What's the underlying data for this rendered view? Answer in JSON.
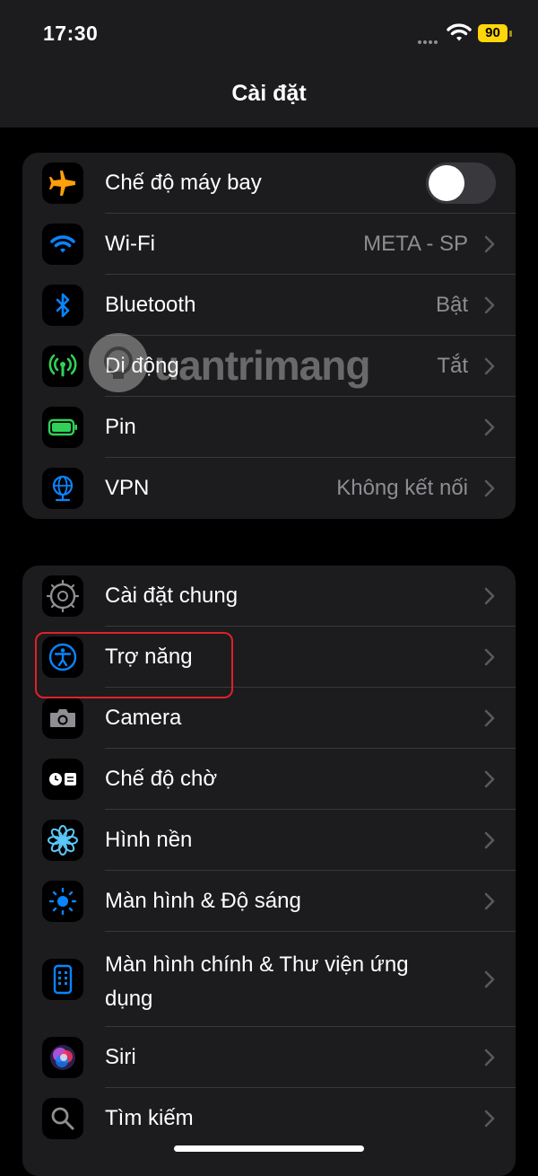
{
  "status_bar": {
    "time": "17:30",
    "battery_level": "90",
    "battery_color": "#ffd60a"
  },
  "navigation": {
    "title": "Cài đặt"
  },
  "group1": [
    {
      "label": "Chế độ máy bay",
      "value": "",
      "icon": "airplane-icon",
      "toggle": false,
      "icon_color": "#ff9f0a"
    },
    {
      "label": "Wi-Fi",
      "value": "META - SP",
      "icon": "wifi-icon",
      "icon_color": "#0a84ff"
    },
    {
      "label": "Bluetooth",
      "value": "Bật",
      "icon": "bluetooth-icon",
      "icon_color": "#0a84ff"
    },
    {
      "label": "Di động",
      "value": "Tắt",
      "icon": "cellular-icon",
      "icon_color": "#30d158"
    },
    {
      "label": "Pin",
      "value": "",
      "icon": "battery-icon",
      "icon_color": "#30d158"
    },
    {
      "label": "VPN",
      "value": "Không kết nối",
      "icon": "globe-icon",
      "icon_color": "#0a84ff"
    }
  ],
  "group2": [
    {
      "label": "Cài đặt chung",
      "icon": "gear-icon",
      "icon_color": "#8e8e93"
    },
    {
      "label": "Trợ năng",
      "icon": "accessibility-icon",
      "icon_color": "#0a84ff"
    },
    {
      "label": "Camera",
      "icon": "camera-icon",
      "icon_color": "#8e8e93"
    },
    {
      "label": "Chế độ chờ",
      "icon": "standby-icon",
      "icon_color": "#ffffff"
    },
    {
      "label": "Hình nền",
      "icon": "flower-icon",
      "icon_color": "#5ac8fa"
    },
    {
      "label": "Màn hình & Độ sáng",
      "icon": "sun-icon",
      "icon_color": "#0a84ff"
    },
    {
      "label": "Màn hình chính & Thư viện ứng dụng",
      "icon": "phone-grid-icon",
      "icon_color": "#0a84ff"
    },
    {
      "label": "Siri",
      "icon": "siri-icon",
      "icon_color": "#bf5af2"
    },
    {
      "label": "Tìm kiếm",
      "icon": "search-icon",
      "icon_color": "#8e8e93"
    }
  ],
  "watermark": {
    "text": "uantrimang"
  },
  "colors": {
    "highlight_border": "#e0202a",
    "group_bg": "#1c1c1e",
    "secondary_text": "#8d8d92"
  }
}
